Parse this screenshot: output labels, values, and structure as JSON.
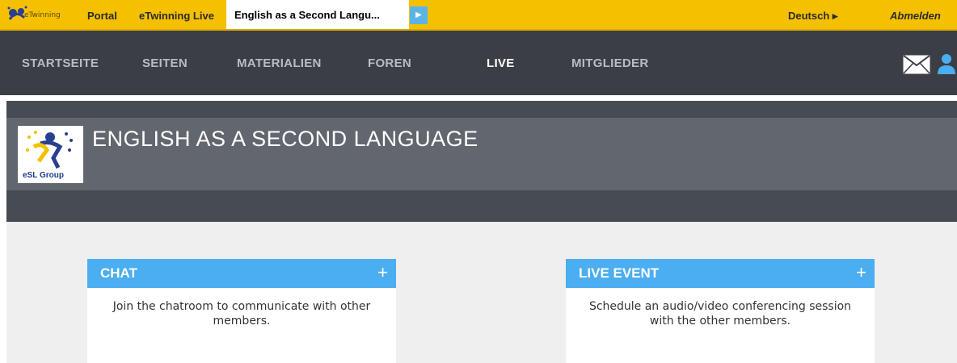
{
  "topbar": {
    "logo_text": "eTwinning",
    "links": [
      "Portal",
      "eTwinning Live"
    ],
    "active_tab": "English as a Second Langu...",
    "language": "Deutsch ▸",
    "logout": "Abmelden"
  },
  "nav": {
    "items": [
      "STARTSEITE",
      "SEITEN",
      "MATERIALIEN",
      "FOREN",
      "LIVE",
      "MITGLIEDER"
    ],
    "active": "LIVE"
  },
  "group": {
    "title": "ENGLISH AS A SECOND LANGUAGE",
    "logo_text": "eSL Group"
  },
  "cards": [
    {
      "title": "CHAT",
      "plus": "+",
      "description": "Join the chatroom to communicate with other members."
    },
    {
      "title": "LIVE EVENT",
      "plus": "+",
      "description": "Schedule an audio/video conferencing session with the other members."
    }
  ],
  "colors": {
    "topbar": "#f4c000",
    "nav": "#3b3e45",
    "accent": "#4baef0"
  }
}
